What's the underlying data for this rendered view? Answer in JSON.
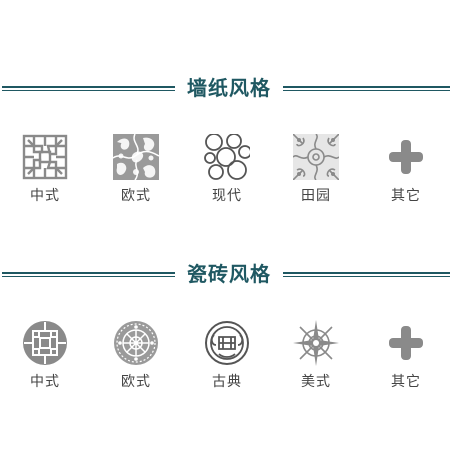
{
  "sections": [
    {
      "title": "墙纸风格",
      "items": [
        {
          "label": "中式",
          "icon": "chinese-lattice-icon"
        },
        {
          "label": "欧式",
          "icon": "damask-pattern-icon"
        },
        {
          "label": "现代",
          "icon": "circles-pattern-icon"
        },
        {
          "label": "田园",
          "icon": "floral-tile-icon"
        },
        {
          "label": "其它",
          "icon": "plus-icon"
        }
      ]
    },
    {
      "title": "瓷砖风格",
      "items": [
        {
          "label": "中式",
          "icon": "chinese-medallion-icon"
        },
        {
          "label": "欧式",
          "icon": "european-medallion-icon"
        },
        {
          "label": "古典",
          "icon": "classical-knot-icon"
        },
        {
          "label": "美式",
          "icon": "american-star-icon"
        },
        {
          "label": "其它",
          "icon": "plus-icon"
        }
      ]
    }
  ],
  "colors": {
    "accent": "#1f5862",
    "icon_gray": "#8a8a8a",
    "label": "#444444"
  }
}
